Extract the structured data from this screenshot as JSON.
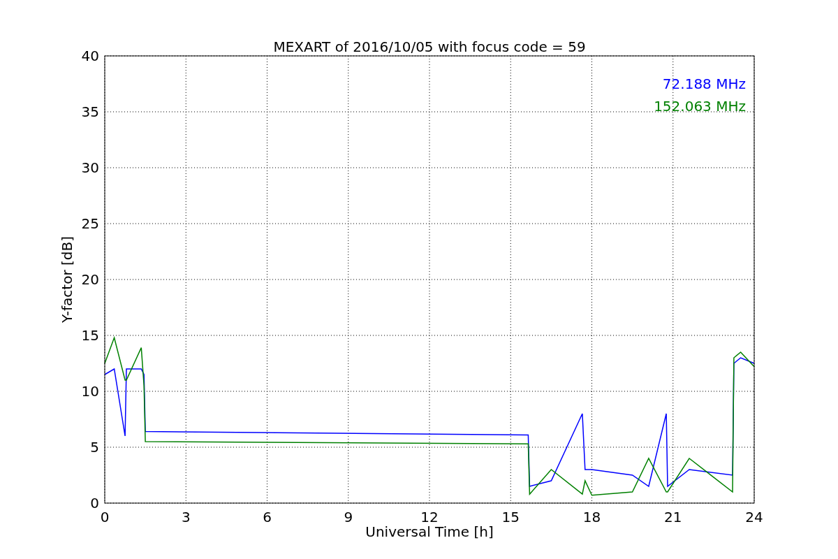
{
  "figure": {
    "chart_data": {
      "type": "line",
      "title": "MEXART of 2016/10/05 with focus code = 59",
      "xlabel": "Universal Time [h]",
      "ylabel": "Y-factor [dB]",
      "x": [
        0,
        0.35,
        0.75,
        0.8,
        1.35,
        1.45,
        1.5,
        15.65,
        15.7,
        16.5,
        17.65,
        17.75,
        18,
        19.5,
        20.1,
        20.75,
        20.8,
        21.6,
        23.2,
        23.25,
        23.5,
        24
      ],
      "series": [
        {
          "name": "72.188 MHz",
          "color": "#0000ff",
          "values": [
            11.5,
            12,
            6,
            12,
            12,
            11.5,
            6.4,
            6.1,
            1.5,
            2,
            8,
            3,
            3,
            2.5,
            1.5,
            8,
            1.5,
            3,
            2.5,
            12.5,
            13,
            12.5
          ]
        },
        {
          "name": "152.063 MHz",
          "color": "#008000",
          "values": [
            12.5,
            14.8,
            11,
            11,
            13.9,
            10.5,
            5.5,
            5.3,
            0.8,
            3,
            0.8,
            2,
            0.7,
            1,
            4,
            1,
            1,
            4,
            1,
            13,
            13.5,
            12.2
          ]
        }
      ],
      "grid": true,
      "xlim": [
        0,
        24
      ],
      "ylim": [
        0,
        40
      ],
      "xticks": [
        0,
        3,
        6,
        9,
        12,
        15,
        18,
        21,
        24
      ],
      "yticks": [
        0,
        5,
        10,
        15,
        20,
        25,
        30,
        35,
        40
      ]
    }
  }
}
